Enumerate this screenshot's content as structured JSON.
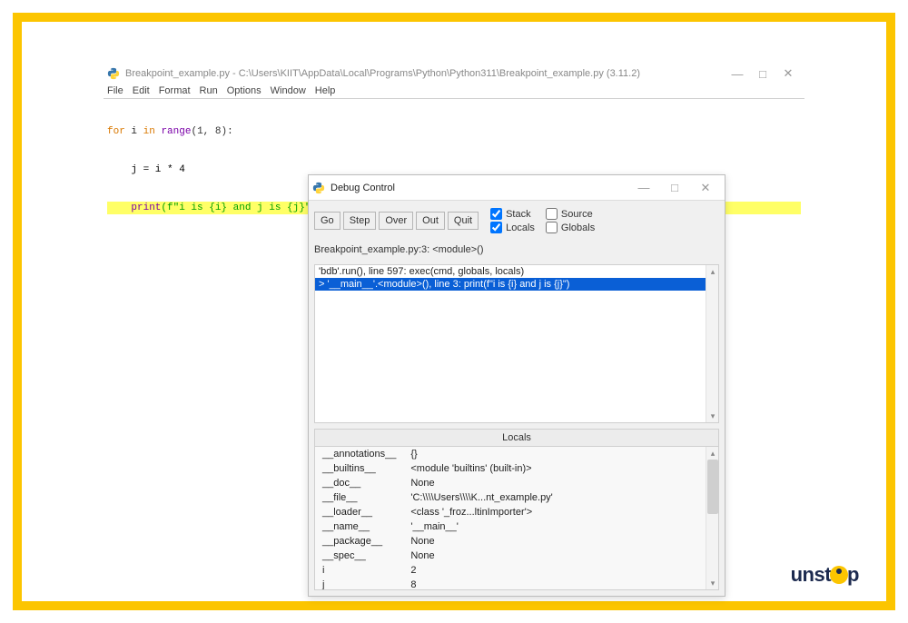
{
  "editor": {
    "title": "Breakpoint_example.py - C:\\Users\\KIIT\\AppData\\Local\\Programs\\Python\\Python311\\Breakpoint_example.py (3.11.2)",
    "menu": [
      "File",
      "Edit",
      "Format",
      "Run",
      "Options",
      "Window",
      "Help"
    ],
    "code": {
      "line1": {
        "kw1": "for",
        "var1": "i",
        "kw2": "in",
        "func": "range",
        "args": "(1, 8)",
        "colon": ":"
      },
      "line2": "    j = i * 4",
      "line3_prefix": "    ",
      "line3_func": "print",
      "line3_rest": "(f\"i is {i} and j is {j}\")"
    }
  },
  "debug": {
    "title": "Debug Control",
    "buttons": {
      "go": "Go",
      "step": "Step",
      "over": "Over",
      "out": "Out",
      "quit": "Quit"
    },
    "checks": {
      "stack": "Stack",
      "source": "Source",
      "locals": "Locals",
      "globals": "Globals"
    },
    "status": "Breakpoint_example.py:3: <module>()",
    "stack": [
      "'bdb'.run(), line 597: exec(cmd, globals, locals)",
      "> '__main__'.<module>(), line 3: print(f\"i is {i} and j is {j}\")"
    ],
    "locals_header": "Locals",
    "locals": [
      {
        "k": "__annotations__",
        "v": "{}"
      },
      {
        "k": "__builtins__",
        "v": "<module 'builtins' (built-in)>"
      },
      {
        "k": "__doc__",
        "v": "None"
      },
      {
        "k": "__file__",
        "v": "'C:\\\\\\\\Users\\\\\\\\K...nt_example.py'"
      },
      {
        "k": "__loader__",
        "v": "<class '_froz...ltinImporter'>"
      },
      {
        "k": "__name__",
        "v": "'__main__'"
      },
      {
        "k": "__package__",
        "v": "None"
      },
      {
        "k": "__spec__",
        "v": "None"
      },
      {
        "k": "i",
        "v": "2"
      },
      {
        "k": "j",
        "v": "8"
      }
    ]
  },
  "logo": {
    "left": "unst",
    "right": "p"
  }
}
